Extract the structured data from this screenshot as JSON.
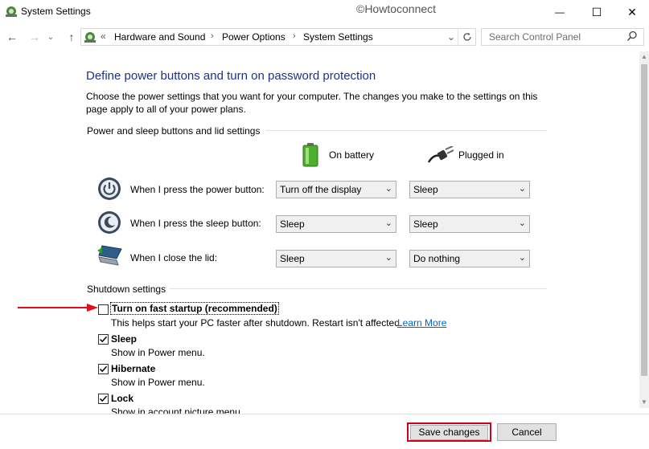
{
  "window": {
    "title": "System Settings",
    "watermark": "©Howtoconnect",
    "minimize": "—",
    "maximize": "☐",
    "close": "✕"
  },
  "nav": {
    "back": "←",
    "forward": "→",
    "recent": "⌄",
    "up": "↑",
    "breadcrumb_prefix": "«",
    "breadcrumbs": [
      "Hardware and Sound",
      "Power Options",
      "System Settings"
    ],
    "separator": "›",
    "dropdown": "⌄",
    "refresh_icon": "refresh-icon"
  },
  "search": {
    "placeholder": "Search Control Panel"
  },
  "page": {
    "title": "Define power buttons and turn on password protection",
    "description": "Choose the power settings that you want for your computer. The changes you make to the settings on this page apply to all of your power plans."
  },
  "power_group": {
    "heading": "Power and sleep buttons and lid settings",
    "col_battery": "On battery",
    "col_plugged": "Plugged in",
    "rows": [
      {
        "label": "When I press the power button:",
        "battery": "Turn off the display",
        "plugged": "Sleep",
        "icon": "power-button-icon"
      },
      {
        "label": "When I press the sleep button:",
        "battery": "Sleep",
        "plugged": "Sleep",
        "icon": "sleep-button-icon"
      },
      {
        "label": "When I close the lid:",
        "battery": "Sleep",
        "plugged": "Do nothing",
        "icon": "laptop-lid-icon"
      }
    ]
  },
  "shutdown_group": {
    "heading": "Shutdown settings",
    "options": [
      {
        "title": "Turn on fast startup (recommended)",
        "desc": "This helps start your PC faster after shutdown. Restart isn't affected.",
        "link": "Learn More",
        "checked": false
      },
      {
        "title": "Sleep",
        "desc": "Show in Power menu.",
        "checked": true
      },
      {
        "title": "Hibernate",
        "desc": "Show in Power menu.",
        "checked": true
      },
      {
        "title": "Lock",
        "desc": "Show in account picture menu.",
        "checked": true
      }
    ]
  },
  "footer": {
    "save": "Save changes",
    "cancel": "Cancel"
  },
  "colors": {
    "title_blue": "#1e3287",
    "link_blue": "#0066cc",
    "highlight_red": "#d0001a"
  }
}
